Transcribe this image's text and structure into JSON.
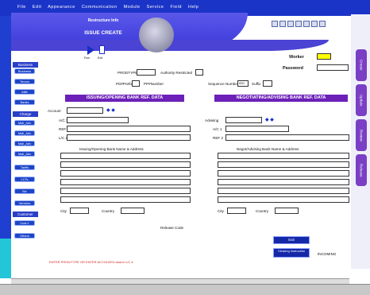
{
  "menu": [
    "File",
    "Edit",
    "Appearance",
    "Communication",
    "Module",
    "Service",
    "Field",
    "Help"
  ],
  "header": {
    "line1": "Restructure Info",
    "line2": "ISSUE CREATE"
  },
  "controls": {
    "play_label": "Run",
    "doc_label": "Exit"
  },
  "login": {
    "worker_label": "Worker",
    "password_label": "Password"
  },
  "sidebar": {
    "sections": [
      {
        "title": "Business",
        "items": [
          "Business",
          "Tenors",
          "Alife",
          "Banks"
        ]
      },
      {
        "title": "Charge",
        "items": [
          "Mail_Adv",
          "Mail_Adv",
          "Mail_Adv",
          "Mail_Adv",
          "Tariffs",
          "LCTs",
          "Biz",
          "Vendors"
        ]
      },
      {
        "title": "Customer",
        "items": [
          "Cust.1",
          "Others"
        ]
      }
    ]
  },
  "right_tabs": [
    "Create",
    "Update",
    "Review",
    "Release"
  ],
  "form": {
    "prodtype": "PRODTYPE",
    "authority": "Authority Restricted",
    "prefix": "PD#Prefix",
    "ppnumber": "PP#Number",
    "sequence": "Sequence Number",
    "sequence_value": "000",
    "suffix": "Suffix"
  },
  "issuing": {
    "title": "ISSUING/OPENING BANK REF. DATA",
    "account": "Account",
    "aic": "A/C 1",
    "ref": "REF",
    "lc": "L/C 2",
    "block": "Issuing/Opening Bank Name & Address",
    "city": "City",
    "country": "Country"
  },
  "negotiating": {
    "title": "NEGOTIATING/ADVISING BANK REF. DATA",
    "account": "Advising",
    "aic": "A/C 1",
    "ref": "REF 2",
    "block": "Negot/Advising Bank Name & Address",
    "city": "City",
    "country": "Country"
  },
  "release_code": "Release Code",
  "buttons": {
    "exit": "Exit",
    "clearing": "Clearing Instruction",
    "status": "INCOMING"
  },
  "warning": "ENTER PROD/TYPE OR ENTER ACCOUNT# and/or L/C #",
  "colors": {
    "menu": "#1b34c8",
    "header": "#4b43d3",
    "section": "#6c20b8",
    "tab": "#7a3fc4",
    "warning": "#d22222",
    "worker_field": "#ffff00"
  }
}
